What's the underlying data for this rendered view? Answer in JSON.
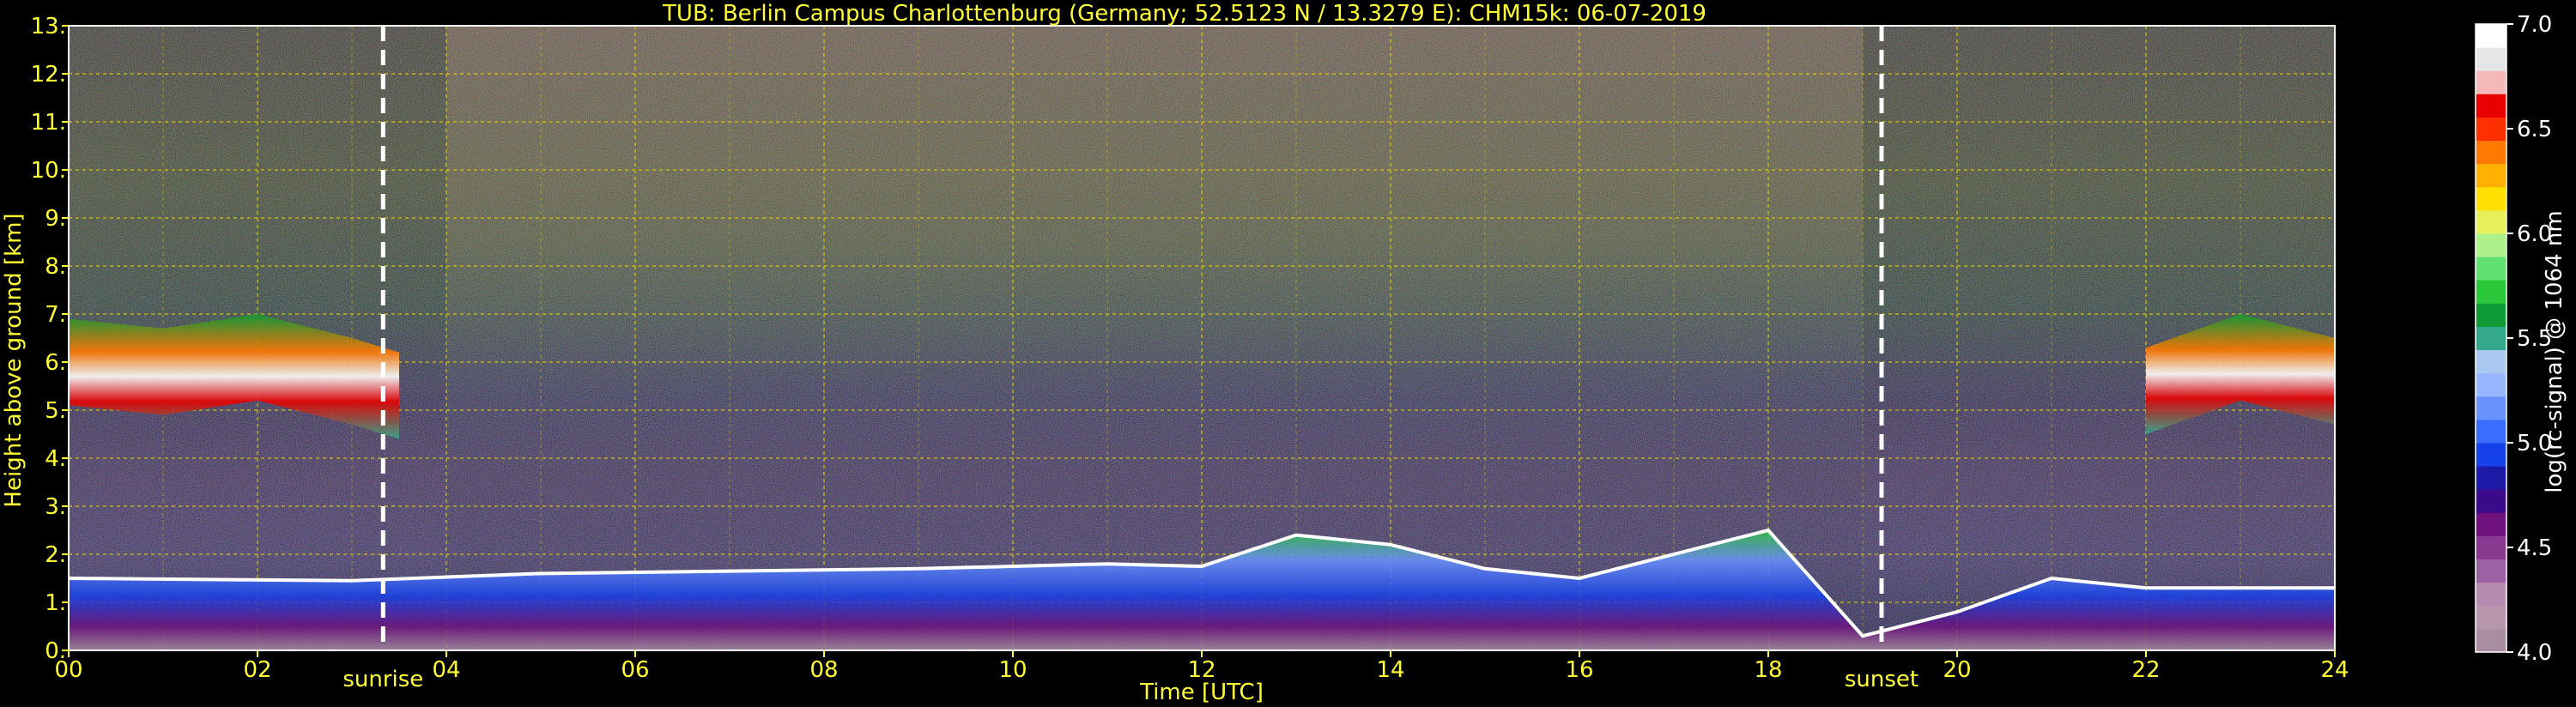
{
  "chart_data": {
    "type": "heatmap",
    "title": "TUB: Berlin Campus Charlottenburg (Germany; 52.5123 N / 13.3279 E):    CHM15k: 06-07-2019",
    "xlabel": "Time [UTC]",
    "ylabel": "Height above ground [km]",
    "xlim": [
      0,
      24
    ],
    "ylim": [
      0,
      13
    ],
    "x_ticks": [
      {
        "value": 0,
        "label": "00"
      },
      {
        "value": 2,
        "label": "02"
      },
      {
        "value": 4,
        "label": "04"
      },
      {
        "value": 6,
        "label": "06"
      },
      {
        "value": 8,
        "label": "08"
      },
      {
        "value": 10,
        "label": "10"
      },
      {
        "value": 12,
        "label": "12"
      },
      {
        "value": 14,
        "label": "14"
      },
      {
        "value": 16,
        "label": "16"
      },
      {
        "value": 18,
        "label": "18"
      },
      {
        "value": 20,
        "label": "20"
      },
      {
        "value": 22,
        "label": "22"
      },
      {
        "value": 24,
        "label": "24"
      }
    ],
    "y_ticks": [
      {
        "value": 0,
        "label": "0."
      },
      {
        "value": 1,
        "label": "1."
      },
      {
        "value": 2,
        "label": "2."
      },
      {
        "value": 3,
        "label": "3."
      },
      {
        "value": 4,
        "label": "4."
      },
      {
        "value": 5,
        "label": "5."
      },
      {
        "value": 6,
        "label": "6."
      },
      {
        "value": 7,
        "label": "7."
      },
      {
        "value": 8,
        "label": "8."
      },
      {
        "value": 9,
        "label": "9."
      },
      {
        "value": 10,
        "label": "10."
      },
      {
        "value": 11,
        "label": "11."
      },
      {
        "value": 12,
        "label": "12."
      },
      {
        "value": 13,
        "label": "13."
      }
    ],
    "grid": true,
    "events": [
      {
        "label": "sunrise",
        "time": 3.33
      },
      {
        "label": "sunset",
        "time": 19.2
      }
    ],
    "colorbar": {
      "label": "log(rc-signal) @ 1064 nm",
      "range": [
        4.0,
        7.0
      ],
      "ticks": [
        {
          "value": 4.0,
          "label": "4.0"
        },
        {
          "value": 4.5,
          "label": "4.5"
        },
        {
          "value": 5.0,
          "label": "5.0"
        },
        {
          "value": 5.5,
          "label": "5.5"
        },
        {
          "value": 6.0,
          "label": "6.0"
        },
        {
          "value": 6.5,
          "label": "6.5"
        },
        {
          "value": 7.0,
          "label": "7.0"
        }
      ],
      "colors": [
        "#a88ea0",
        "#b896ad",
        "#b58cb0",
        "#9a62a3",
        "#86398f",
        "#6e117c",
        "#3a0a8a",
        "#1e1aa8",
        "#1640e8",
        "#3a6cff",
        "#6a92ff",
        "#98b6ff",
        "#a8c8f0",
        "#34a88a",
        "#0e9a34",
        "#2cc63a",
        "#60e070",
        "#aef08a",
        "#e6f05a",
        "#ffe000",
        "#ffb000",
        "#ff7800",
        "#ff3000",
        "#e80000",
        "#f4b8b8",
        "#e6e6e6",
        "#ffffff"
      ]
    },
    "features": [
      {
        "name": "boundary layer top",
        "x": [
          0,
          3,
          5,
          7,
          9,
          11,
          12,
          13,
          14,
          15,
          16,
          18,
          19,
          20,
          21,
          22,
          24
        ],
        "y": [
          1.5,
          1.45,
          1.6,
          1.65,
          1.7,
          1.8,
          1.75,
          2.4,
          2.2,
          1.7,
          1.5,
          2.5,
          0.3,
          0.8,
          1.5,
          1.3,
          1.3
        ]
      },
      {
        "name": "cloud layer",
        "x": [
          0,
          1,
          2,
          3,
          3.5,
          22,
          23,
          24
        ],
        "y": [
          6.0,
          5.8,
          6.1,
          5.6,
          5.3,
          5.4,
          6.1,
          5.6
        ]
      }
    ]
  }
}
